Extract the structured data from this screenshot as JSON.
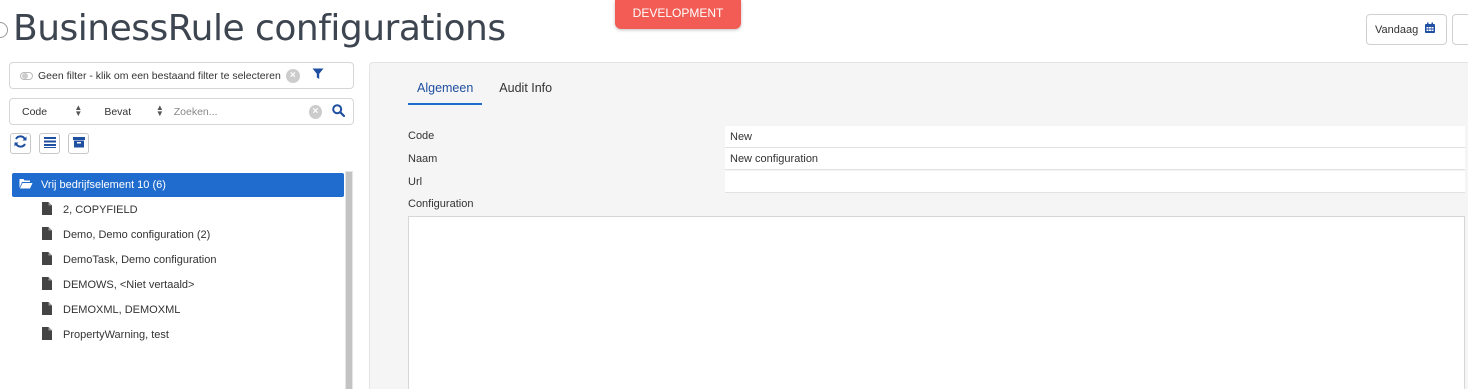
{
  "header": {
    "title": "BusinessRule configurations",
    "environment": "DEVELOPMENT",
    "today_label": "Vandaag"
  },
  "colors": {
    "accent": "#1f6cce",
    "environment_badge": "#f25c54",
    "title": "#3d4550"
  },
  "filter": {
    "text": "Geen filter - klik om een bestaand filter te selecteren"
  },
  "search": {
    "field": "Code",
    "operator": "Bevat",
    "placeholder": "Zoeken..."
  },
  "toolbar": {
    "icons": [
      "refresh-icon",
      "list-icon",
      "archive-icon"
    ]
  },
  "tree": {
    "folder_label": "Vrij bedrijfselement 10 (6)",
    "items": [
      {
        "label": "2, COPYFIELD"
      },
      {
        "label": "Demo, Demo configuration (2)"
      },
      {
        "label": "DemoTask, Demo configuration"
      },
      {
        "label": "DEMOWS, <Niet vertaald>"
      },
      {
        "label": "DEMOXML, DEMOXML"
      },
      {
        "label": "PropertyWarning, test"
      }
    ]
  },
  "tabs": [
    {
      "label": "Algemeen",
      "active": true
    },
    {
      "label": "Audit Info",
      "active": false
    }
  ],
  "form": {
    "code_label": "Code",
    "code_value": "New",
    "naam_label": "Naam",
    "naam_value": "New configuration",
    "url_label": "Url",
    "url_value": "",
    "configuration_label": "Configuration",
    "configuration_value": ""
  }
}
